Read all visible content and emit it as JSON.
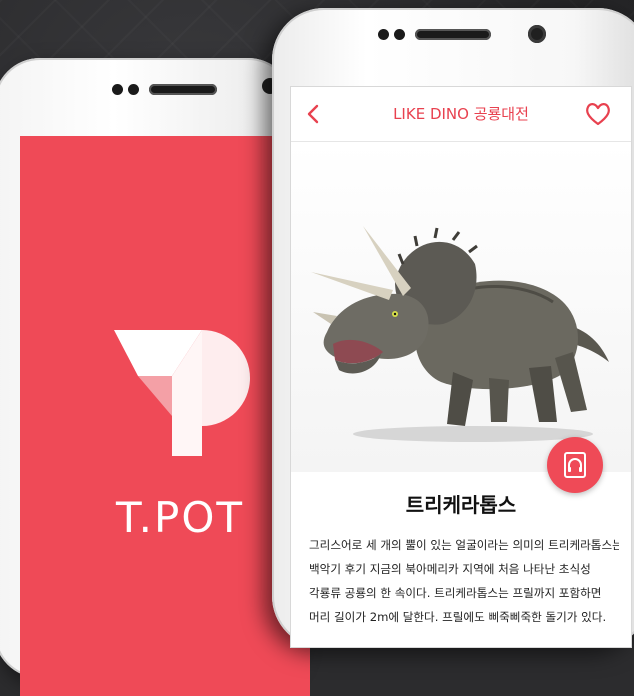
{
  "left_screen": {
    "brand": "T.POT",
    "background_color": "#ef4a57"
  },
  "right_screen": {
    "header": {
      "title": "LIKE DINO 공룡대전",
      "back_icon": "chevron-left-icon",
      "favorite_icon": "heart-icon",
      "accent_color": "#e8414f"
    },
    "audio_icon": "headphones-book-icon",
    "dino_name": "트리케라톱스",
    "description_lines": [
      "그리스어로 세 개의 뿔이 있는 얼굴이라는 의미의 트리케라톱스는",
      "백악기 후기 지금의 북아메리카 지역에 처음 나타난 초식성",
      "각룡류 공룡의 한 속이다. 트리케라톱스는 프릴까지 포함하면",
      "머리 길이가 2m에 달한다. 프릴에도 삐죽삐죽한 돌기가 있다."
    ]
  }
}
